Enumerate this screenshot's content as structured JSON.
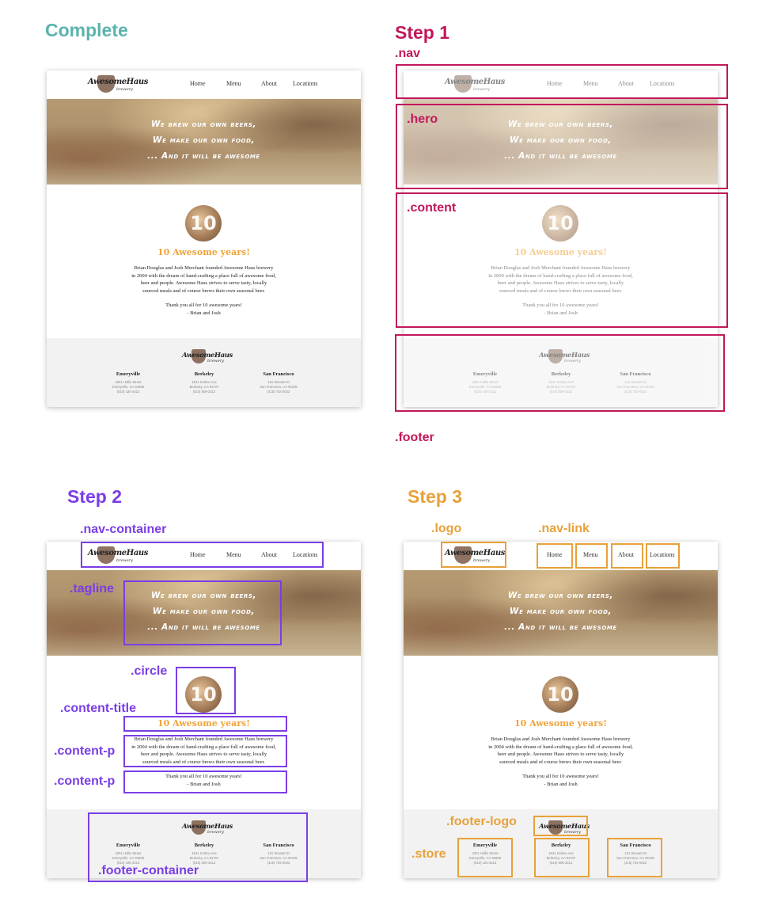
{
  "colors": {
    "complete": "#5bb3ad",
    "step1": "#c2185b",
    "step2": "#7a3ee6",
    "step3": "#e8a13a",
    "title_accent": "#f0a33a"
  },
  "headings": {
    "complete": "Complete",
    "step1": "Step 1",
    "step2": "Step 2",
    "step3": "Step 3"
  },
  "labels": {
    "nav": ".nav",
    "hero": ".hero",
    "content": ".content",
    "footer": ".footer",
    "nav_container": ".nav-container",
    "tagline": ".tagline",
    "circle": ".circle",
    "content_title": ".content-title",
    "content_p": ".content-p",
    "footer_container": ".footer-container",
    "logo": ".logo",
    "nav_link": ".nav-link",
    "footer_logo": ".footer-logo",
    "store": ".store"
  },
  "site": {
    "logo_text": "AwesomeHaus",
    "logo_sub": "brewery",
    "nav_links": [
      "Home",
      "Menu",
      "About",
      "Locations"
    ],
    "tagline": [
      "We brew our own beers,",
      "We make our own food,",
      "... And it will be awesome"
    ],
    "circle_number": "10",
    "content_title": "10 Awesome years!",
    "content_p1": [
      "Brian Douglas and Josh Merchant founded Awesome Haus brewery",
      "in 2004 with the dream of hand-crafting a place full of awesome food,",
      "beer and people. Awesome Haus strives to serve tasty, locally",
      "sourced meals and of course brews their own seasonal beer."
    ],
    "content_p2": [
      "Thank you all for 10 awesome years!",
      "- Brian and Josh"
    ],
    "stores": [
      {
        "name": "Emeryville",
        "lines": [
          "4301 Hollis Street",
          "Emeryville, CA 94608",
          "(510) 420-3413"
        ]
      },
      {
        "name": "Berkeley",
        "lines": [
          "1641 Solano Ave",
          "Berkeley, CA 94707",
          "(510) 809-3212"
        ]
      },
      {
        "name": "San Francisco",
        "lines": [
          "121 Stewart St",
          "San Francisco, CA 94105",
          "(415) 702-0022"
        ]
      }
    ]
  }
}
